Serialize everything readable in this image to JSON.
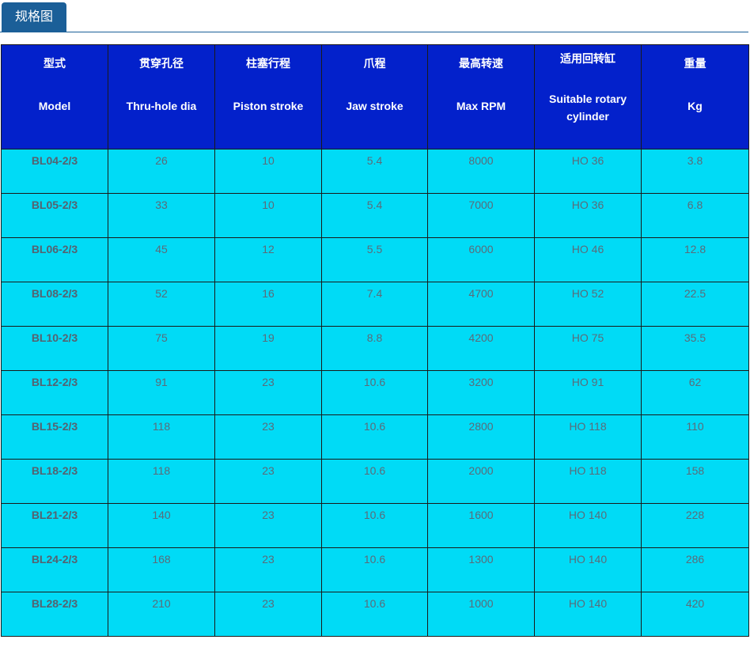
{
  "tab": {
    "label": "规格图"
  },
  "table": {
    "headers": [
      {
        "cn": "型式",
        "en": "Model"
      },
      {
        "cn": "贯穿孔径",
        "en": "Thru-hole dia"
      },
      {
        "cn": "柱塞行程",
        "en": "Piston stroke"
      },
      {
        "cn": "爪程",
        "en": "Jaw stroke"
      },
      {
        "cn": "最高转速",
        "en": "Max RPM"
      },
      {
        "cn": "适用回转缸",
        "en": "Suitable rotary cylinder"
      },
      {
        "cn": "重量",
        "en": "Kg"
      }
    ],
    "rows": [
      [
        "BL04-2/3",
        "26",
        "10",
        "5.4",
        "8000",
        "HO 36",
        "3.8"
      ],
      [
        "BL05-2/3",
        "33",
        "10",
        "5.4",
        "7000",
        "HO 36",
        "6.8"
      ],
      [
        "BL06-2/3",
        "45",
        "12",
        "5.5",
        "6000",
        "HO 46",
        "12.8"
      ],
      [
        "BL08-2/3",
        "52",
        "16",
        "7.4",
        "4700",
        "HO 52",
        "22.5"
      ],
      [
        "BL10-2/3",
        "75",
        "19",
        "8.8",
        "4200",
        "HO 75",
        "35.5"
      ],
      [
        "BL12-2/3",
        "91",
        "23",
        "10.6",
        "3200",
        "HO 91",
        "62"
      ],
      [
        "BL15-2/3",
        "118",
        "23",
        "10.6",
        "2800",
        "HO 118",
        "110"
      ],
      [
        "BL18-2/3",
        "118",
        "23",
        "10.6",
        "2000",
        "HO 118",
        "158"
      ],
      [
        "BL21-2/3",
        "140",
        "23",
        "10.6",
        "1600",
        "HO 140",
        "228"
      ],
      [
        "BL24-2/3",
        "168",
        "23",
        "10.6",
        "1300",
        "HO 140",
        "286"
      ],
      [
        "BL28-2/3",
        "210",
        "23",
        "10.6",
        "1000",
        "HO 140",
        "420"
      ]
    ]
  }
}
